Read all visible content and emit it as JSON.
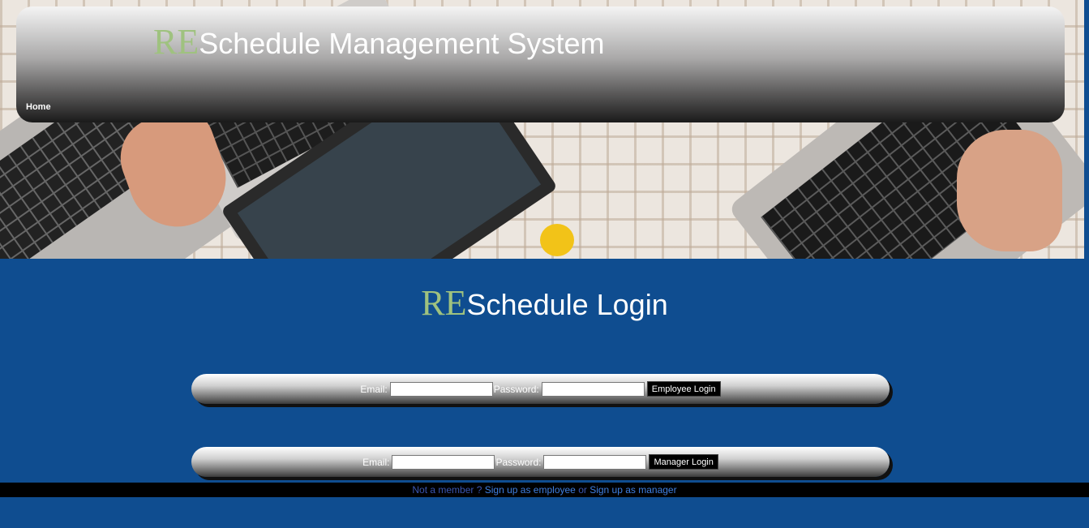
{
  "header": {
    "logo_prefix": "RE",
    "title": "Schedule Management System",
    "nav": {
      "home": "Home"
    }
  },
  "login": {
    "title_prefix": "RE",
    "title": "Schedule Login",
    "employee": {
      "email_label": "Email:",
      "password_label": "Password:",
      "email_value": "",
      "password_value": "",
      "button": "Employee Login"
    },
    "manager": {
      "email_label": "Email:",
      "password_label": "Password:",
      "email_value": "",
      "password_value": "",
      "button": "Manager Login"
    }
  },
  "footer": {
    "prompt": "Not a member ?",
    "employee_link": "Sign up as employee",
    "or": "or",
    "manager_link": "Sign up as manager"
  },
  "colors": {
    "page_background": "#0f4d90",
    "logo_accent": "#9fc27f",
    "footer_link": "#3f7fe0"
  }
}
